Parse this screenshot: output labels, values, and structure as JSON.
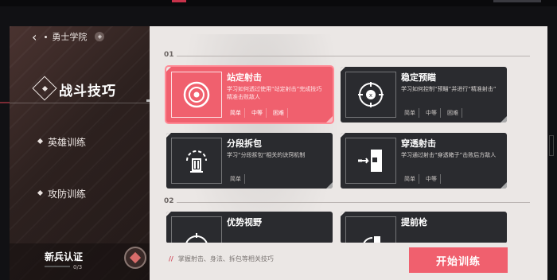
{
  "header": {
    "back_icon": "‹",
    "title": "勇士学院",
    "badge": "◈"
  },
  "nav": {
    "items": [
      {
        "label": "战斗技巧",
        "active": true
      },
      {
        "label": "英雄训练",
        "active": false
      },
      {
        "label": "攻防训练",
        "active": false
      }
    ]
  },
  "certification": {
    "label": "新兵认证",
    "progress": "0/3"
  },
  "sections": [
    {
      "label": "01"
    },
    {
      "label": "02"
    }
  ],
  "cards": [
    {
      "title": "站定射击",
      "desc": "学习如何透过使用“站定射击”完成技巧精准击败敌人",
      "tags": [
        "简单",
        "中等",
        "困难"
      ],
      "icon": "target-icon",
      "active": true
    },
    {
      "title": "稳定预瞄",
      "desc": "学习如何控制“预瞄”并进行“精准射击”",
      "tags": [
        "简单",
        "中等",
        "困难"
      ],
      "icon": "aim-bot-icon",
      "active": false
    },
    {
      "title": "分段拆包",
      "desc": "学习“分段拆包”相关的诀窍机制",
      "tags": [
        "简单"
      ],
      "icon": "bomb-defuse-icon",
      "active": false
    },
    {
      "title": "穿透射击",
      "desc": "学习通过射击“穿透箱子”击败后方敌人",
      "tags": [
        "简单",
        "中等"
      ],
      "icon": "wall-penetration-icon",
      "active": false
    },
    {
      "title": "优势视野",
      "desc": "",
      "tags": [],
      "icon": "target-icon",
      "active": false
    },
    {
      "title": "提前枪",
      "desc": "",
      "tags": [],
      "icon": "peek-icon",
      "active": false
    }
  ],
  "footer": {
    "hint": "掌握射击、身法、拆包等相关技巧",
    "start_label": "开始训练"
  },
  "colors": {
    "accent": "#f0606e",
    "card_dark": "#2a2b2f",
    "panel_light": "#ebe7e5"
  }
}
